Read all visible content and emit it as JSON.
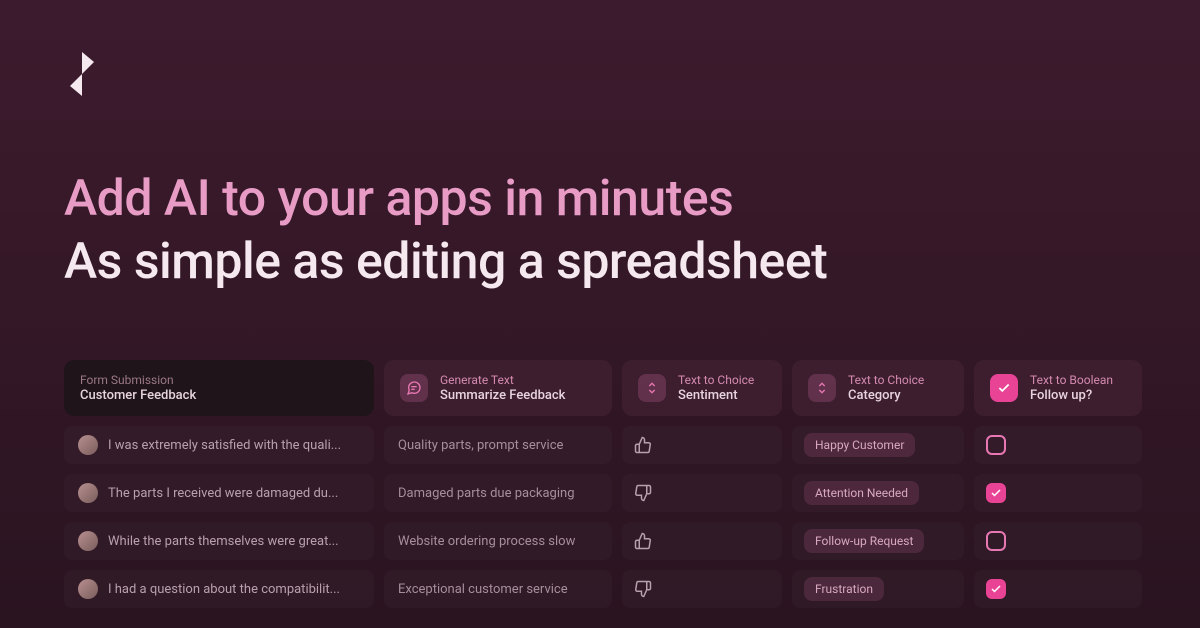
{
  "headline": {
    "line1": "Add AI to your apps in minutes",
    "line2": "As simple as editing a spreadsheet"
  },
  "columns": [
    {
      "label": "Form Submission",
      "title": "Customer Feedback"
    },
    {
      "label": "Generate Text",
      "title": "Summarize Feedback"
    },
    {
      "label": "Text to Choice",
      "title": "Sentiment"
    },
    {
      "label": "Text to Choice",
      "title": "Category"
    },
    {
      "label": "Text to Boolean",
      "title": "Follow up?"
    }
  ],
  "rows": [
    {
      "feedback": "I was extremely satisfied with the quali...",
      "summary": "Quality parts, prompt service",
      "sentiment": "up",
      "category": "Happy Customer",
      "followup": false
    },
    {
      "feedback": "The parts I received were damaged du...",
      "summary": "Damaged parts due packaging",
      "sentiment": "down",
      "category": "Attention Needed",
      "followup": true
    },
    {
      "feedback": "While the parts themselves were great...",
      "summary": "Website ordering process slow",
      "sentiment": "up",
      "category": "Follow-up Request",
      "followup": false
    },
    {
      "feedback": "I had a question about the compatibilit...",
      "summary": "Exceptional customer service",
      "sentiment": "down",
      "category": "Frustration",
      "followup": true
    }
  ]
}
